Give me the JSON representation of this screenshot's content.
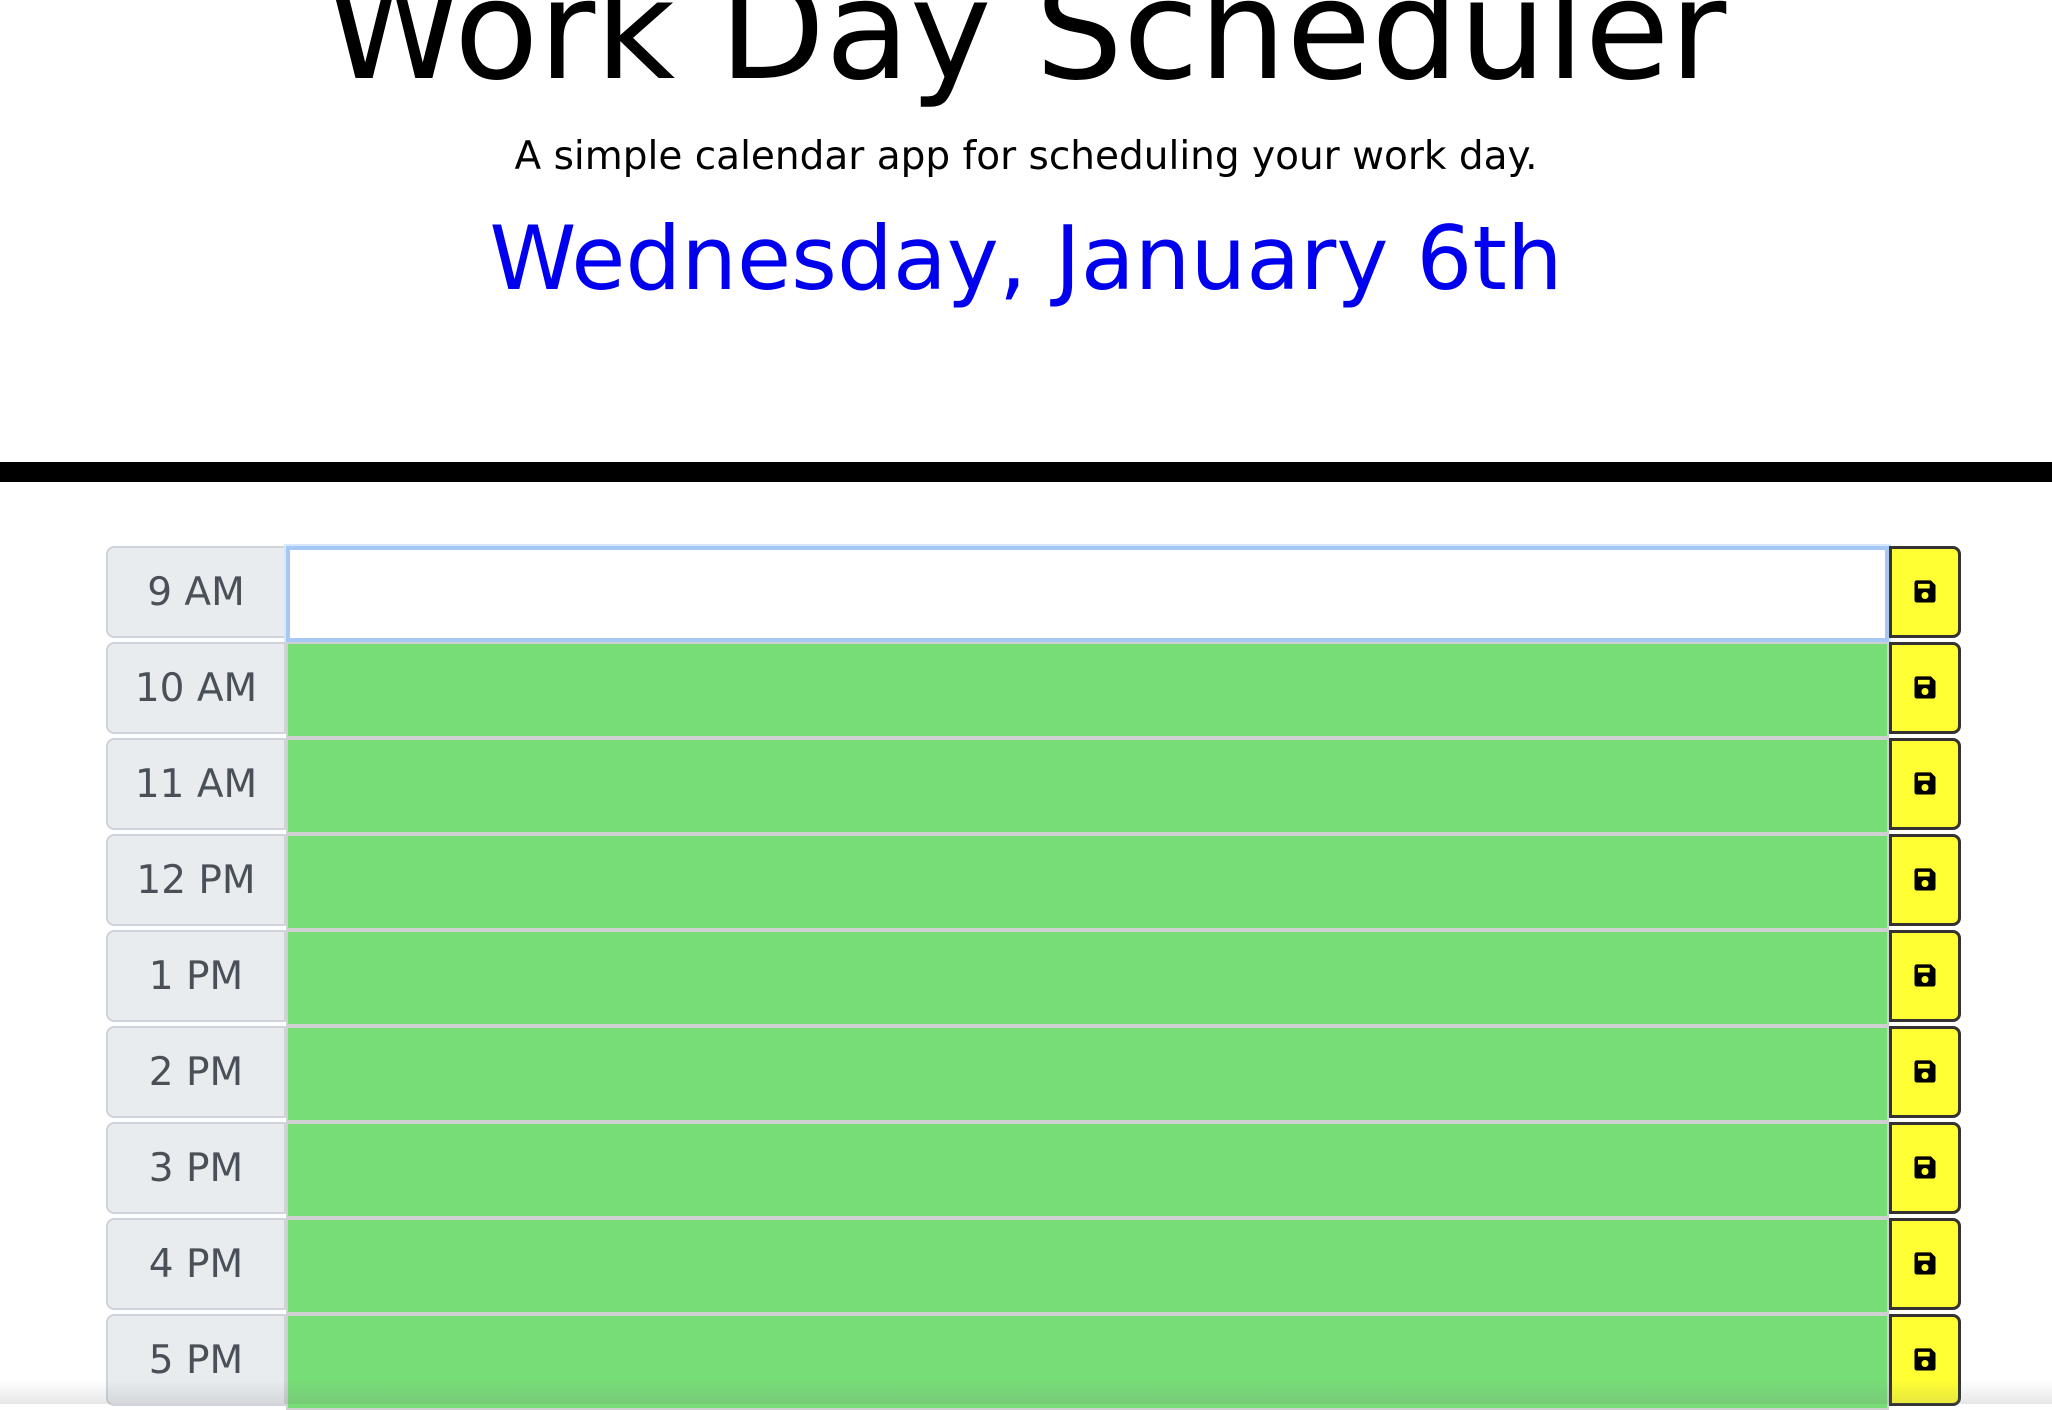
{
  "header": {
    "title": "Work Day Scheduler",
    "subtitle": "A simple calendar app for scheduling your work day.",
    "current_day": "Wednesday, January 6th"
  },
  "colors": {
    "present": "#ffffff",
    "future": "#77dd77",
    "save_button": "#ffff33",
    "current_day_text": "#0000ee"
  },
  "icons": {
    "save": "floppy-disk-icon"
  },
  "schedule": {
    "rows": [
      {
        "hour": "9 AM",
        "state": "present",
        "text": ""
      },
      {
        "hour": "10 AM",
        "state": "future",
        "text": ""
      },
      {
        "hour": "11 AM",
        "state": "future",
        "text": ""
      },
      {
        "hour": "12 PM",
        "state": "future",
        "text": ""
      },
      {
        "hour": "1 PM",
        "state": "future",
        "text": ""
      },
      {
        "hour": "2 PM",
        "state": "future",
        "text": ""
      },
      {
        "hour": "3 PM",
        "state": "future",
        "text": ""
      },
      {
        "hour": "4 PM",
        "state": "future",
        "text": ""
      },
      {
        "hour": "5 PM",
        "state": "future",
        "text": ""
      }
    ]
  }
}
